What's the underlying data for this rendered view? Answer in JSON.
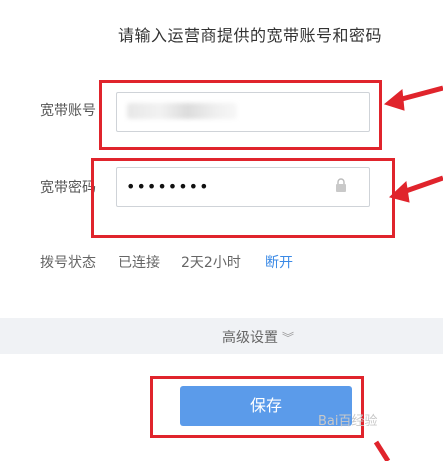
{
  "header": {
    "instruction": "请输入运营商提供的宽带账号和密码"
  },
  "form": {
    "account_label": "宽带账号",
    "password_label": "宽带密码",
    "password_value": "••••••••"
  },
  "status": {
    "label": "拨号状态",
    "state": "已连接",
    "duration": "2天2小时",
    "disconnect_link": "断开"
  },
  "advanced": {
    "label": "高级设置",
    "icon": "chevron-double-down-icon"
  },
  "actions": {
    "save_label": "保存"
  },
  "annotation": {
    "highlight_color": "#e0242c",
    "watermark": "Bai百经验"
  },
  "colors": {
    "accent": "#5b9bea",
    "link": "#3b8ae6",
    "advanced_bar": "#f0f2f5"
  }
}
